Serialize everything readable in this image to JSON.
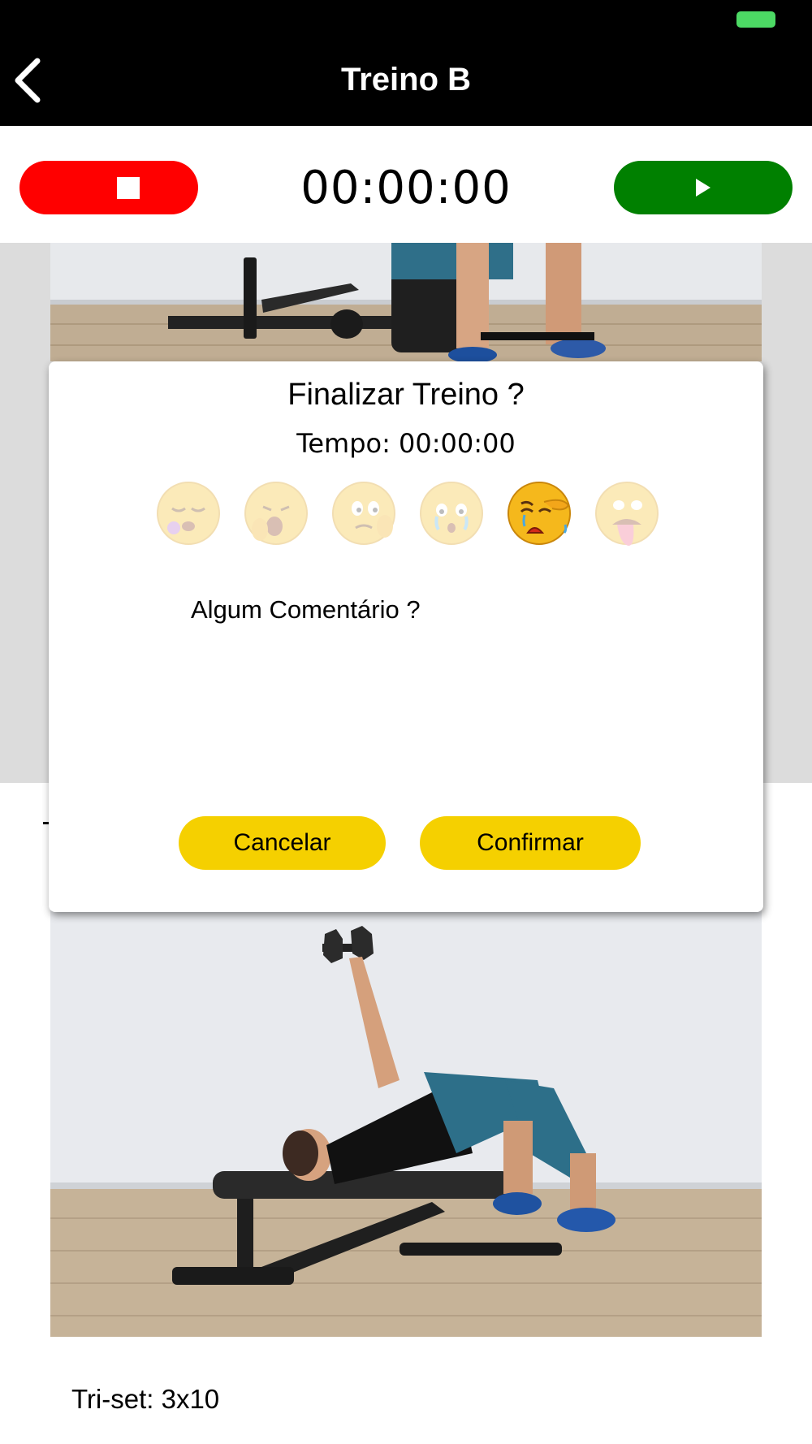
{
  "status_bar": {
    "battery_color": "#4cd964"
  },
  "nav": {
    "title": "Treino B",
    "back_icon": "chevron-left-icon"
  },
  "timer": {
    "value": "00:00:00",
    "stop_color": "#ff0000",
    "play_color": "#008000",
    "stop_icon": "stop-icon",
    "play_icon": "play-icon"
  },
  "content": {
    "triset_label": "Tri-set: 3x10"
  },
  "dialog": {
    "title": "Finalizar Treino ?",
    "time_text": "Tempo: 00:00:00",
    "effort_faces": [
      {
        "icon": "sleeping-face-icon",
        "selected": false
      },
      {
        "icon": "yawning-face-icon",
        "selected": false
      },
      {
        "icon": "thinking-face-icon",
        "selected": false
      },
      {
        "icon": "crying-face-icon",
        "selected": false
      },
      {
        "icon": "exhausted-face-icon",
        "selected": true
      },
      {
        "icon": "tongue-out-exhausted-face-icon",
        "selected": false
      }
    ],
    "comment_label": "Algum Comentário ?",
    "comment_value": "",
    "cancel_label": "Cancelar",
    "confirm_label": "Confirmar",
    "button_color": "#f5d000"
  }
}
